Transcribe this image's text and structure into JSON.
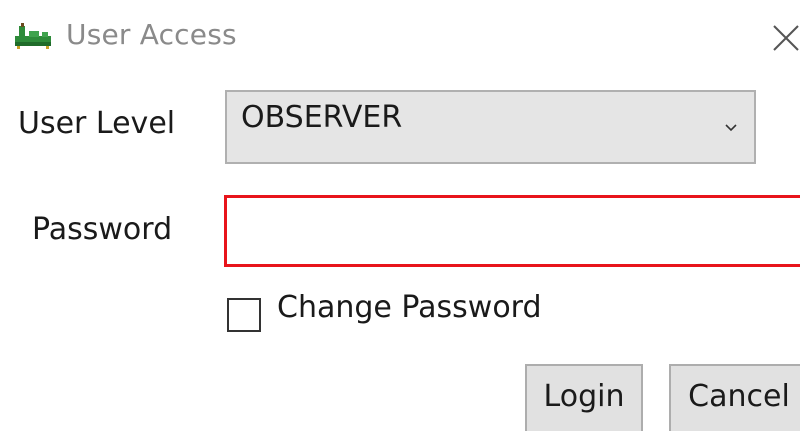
{
  "window": {
    "title": "User Access",
    "icon": "app-board-icon",
    "close_icon": "close-icon"
  },
  "form": {
    "user_level_label": "User Level",
    "user_level_value": "OBSERVER",
    "password_label": "Password",
    "password_value": "",
    "password_border_color": "#e8141b",
    "change_password_label": "Change Password",
    "change_password_checked": false
  },
  "buttons": {
    "login_label": "Login",
    "cancel_label": "Cancel"
  }
}
